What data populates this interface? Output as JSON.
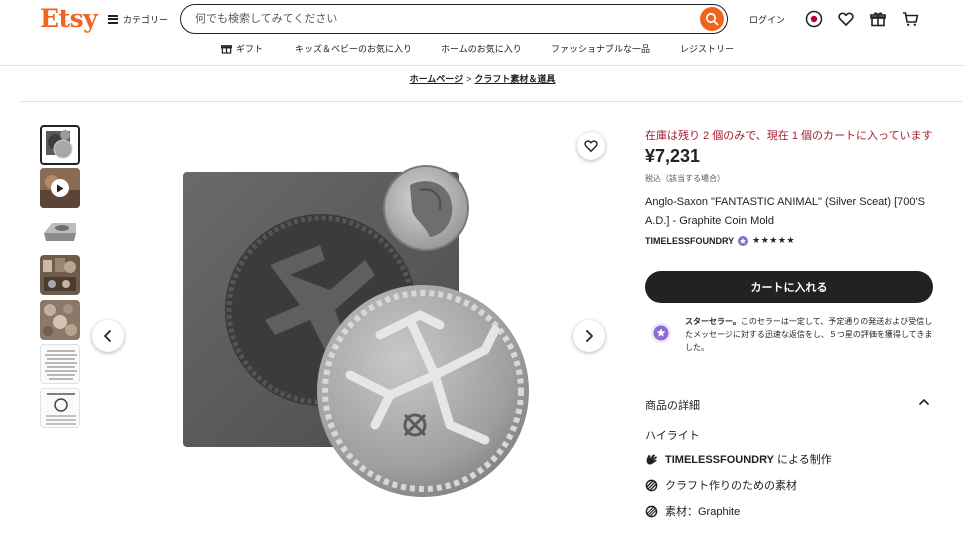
{
  "header": {
    "logo": "Etsy",
    "categories_label": "カテゴリー",
    "search_placeholder": "何でも検索してみてください",
    "login_label": "ログイン"
  },
  "nav": {
    "items": [
      {
        "label": "ギフト",
        "icon": "gift-icon"
      },
      {
        "label": "キッズ＆ベビーのお気に入り"
      },
      {
        "label": "ホームのお気に入り"
      },
      {
        "label": "ファッショナブルな一品"
      },
      {
        "label": "レジストリー"
      }
    ]
  },
  "breadcrumb": {
    "items": [
      "ホームページ",
      "クラフト素材＆道具"
    ],
    "separator": ">"
  },
  "gallery": {
    "thumbnail_count": 7
  },
  "product": {
    "stock_notice": "在庫は残り 2 個のみで、現在 1 個のカートに入っています",
    "price": "¥7,231",
    "tax_note": "税込（該当する場合）",
    "title": "Anglo-Saxon \"FANTASTIC ANIMAL\" (Silver Sceat) [700'S A.D.] - Graphite Coin Mold",
    "shop_name": "TIMELESSFOUNDRY",
    "rating_stars": "★★★★★",
    "rating": 5,
    "add_to_cart": "カートに入れる"
  },
  "star_seller": {
    "label": "スターセラー。",
    "text": "このセラーは一定して、予定通りの発送および受信したメッセージに対する迅速な返信をし、５つ星の評価を獲得してきました。"
  },
  "details": {
    "heading": "商品の詳細",
    "highlights_heading": "ハイライト",
    "rows": [
      {
        "bold": "TIMELESSFOUNDRY",
        "text": " による制作",
        "icon": "hand-icon"
      },
      {
        "bold": "",
        "text": "クラフト作りのための素材",
        "icon": "craft-icon"
      },
      {
        "bold": "",
        "text": "素材：Graphite",
        "icon": "material-icon"
      }
    ]
  },
  "colors": {
    "brand": "#f1641e",
    "stock_text": "#a61a2e",
    "button": "#222222"
  }
}
